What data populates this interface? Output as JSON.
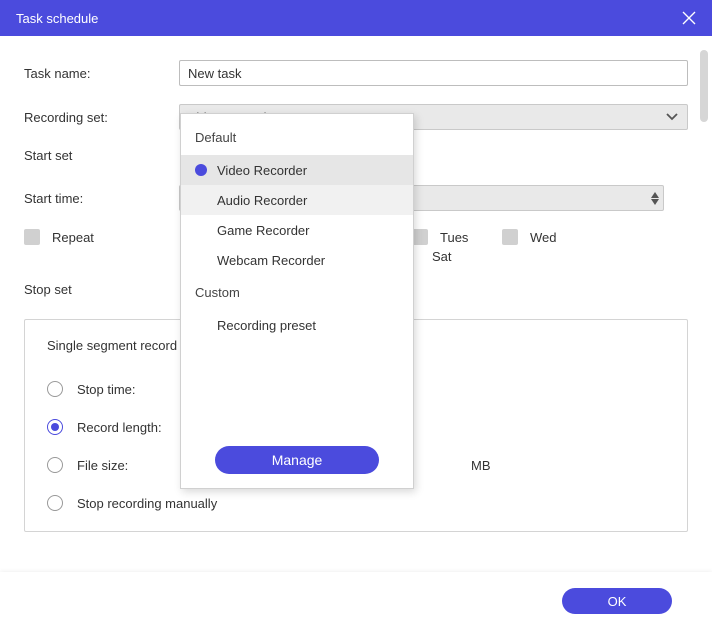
{
  "titlebar": {
    "title": "Task schedule"
  },
  "form": {
    "taskNameLabel": "Task name:",
    "taskNameValue": "New task",
    "recordingSetLabel": "Recording set:",
    "recordingSetValue": "Video Recorder",
    "startSetLabel": "Start set",
    "startTimeLabel": "Start time:",
    "repeatLabel": "Repeat",
    "days": {
      "tues": "Tues",
      "wed": "Wed",
      "sat": "Sat"
    },
    "stopSetLabel": "Stop set",
    "panelTitle": "Single segment record",
    "stopTimeLabel": "Stop time:",
    "recordLengthLabel": "Record length:",
    "fileSizeLabel": "File size:",
    "fileSizeUnit": "MB",
    "stopManualLabel": "Stop recording manually"
  },
  "dropdown": {
    "groupDefault": "Default",
    "items": [
      {
        "label": "Video Recorder",
        "selected": true
      },
      {
        "label": "Audio Recorder",
        "selected": false
      },
      {
        "label": "Game Recorder",
        "selected": false
      },
      {
        "label": "Webcam Recorder",
        "selected": false
      }
    ],
    "groupCustom": "Custom",
    "customItems": [
      {
        "label": "Recording preset"
      }
    ],
    "manageLabel": "Manage"
  },
  "footer": {
    "okLabel": "OK"
  }
}
